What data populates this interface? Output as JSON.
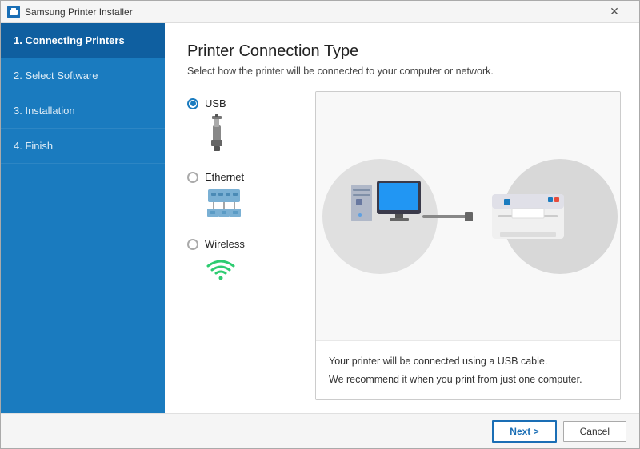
{
  "window": {
    "title": "Samsung Printer Installer",
    "close_label": "✕"
  },
  "sidebar": {
    "items": [
      {
        "id": "connecting-printers",
        "label": "1. Connecting Printers",
        "active": true
      },
      {
        "id": "select-software",
        "label": "2. Select Software",
        "active": false
      },
      {
        "id": "installation",
        "label": "3. Installation",
        "active": false
      },
      {
        "id": "finish",
        "label": "4. Finish",
        "active": false
      }
    ]
  },
  "main": {
    "title": "Printer Connection Type",
    "subtitle": "Select how the printer will be connected to your computer or network.",
    "options": [
      {
        "id": "usb",
        "label": "USB",
        "selected": true
      },
      {
        "id": "ethernet",
        "label": "Ethernet",
        "selected": false
      },
      {
        "id": "wireless",
        "label": "Wireless",
        "selected": false
      }
    ],
    "preview": {
      "description_line1": "Your printer will be connected using a USB cable.",
      "description_line2": "We recommend it when you print from just one computer."
    }
  },
  "footer": {
    "next_label": "Next >",
    "cancel_label": "Cancel"
  }
}
